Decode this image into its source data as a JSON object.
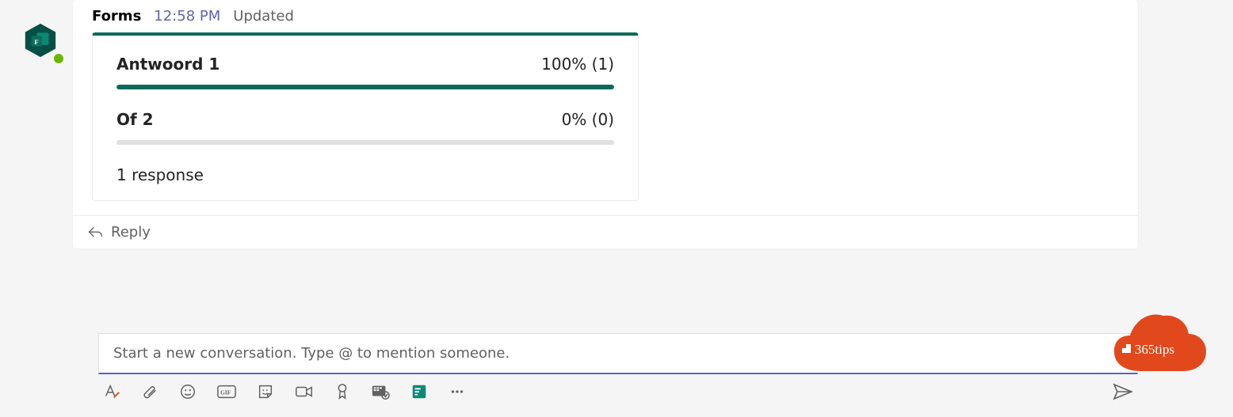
{
  "colors": {
    "teal": "#0a6a5a",
    "purple": "#5b5fc7",
    "brand": "#e1491d"
  },
  "header": {
    "app_name": "Forms",
    "time": "12:58 PM",
    "status": "Updated"
  },
  "poll": {
    "options": [
      {
        "label": "Antwoord 1",
        "value_text": "100% (1)",
        "pct": 100
      },
      {
        "label": "Of 2",
        "value_text": "0% (0)",
        "pct": 0
      }
    ],
    "responses_label": "1 response"
  },
  "reply": {
    "label": "Reply"
  },
  "composer": {
    "placeholder": "Start a new conversation. Type @ to mention someone."
  },
  "brand": {
    "text": "365tips"
  },
  "chart_data": {
    "type": "bar",
    "title": "",
    "xlabel": "",
    "ylabel": "",
    "categories": [
      "Antwoord 1",
      "Of 2"
    ],
    "values": [
      1,
      0
    ],
    "percentages": [
      100,
      0
    ],
    "total_responses": 1,
    "xlim": [
      0,
      100
    ]
  }
}
